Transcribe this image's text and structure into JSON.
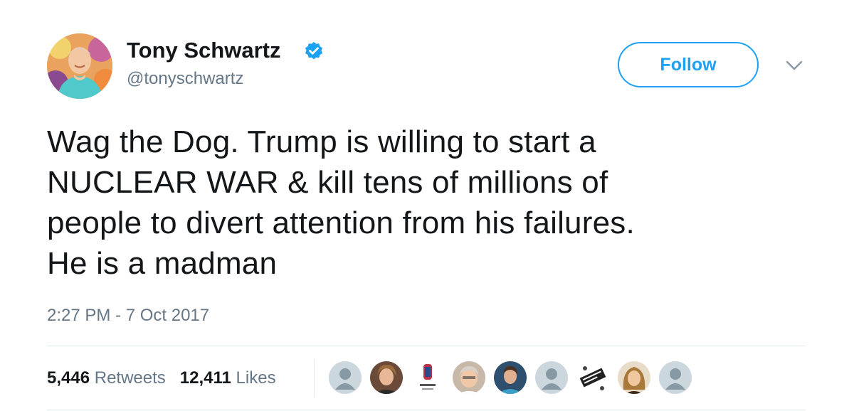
{
  "user": {
    "display_name": "Tony Schwartz",
    "handle": "@tonyschwartz",
    "verified": true
  },
  "actions": {
    "follow_label": "Follow"
  },
  "tweet": {
    "lines": [
      "Wag the Dog. Trump is willing to start a",
      "NUCLEAR WAR & kill tens of millions of",
      "people to divert attention from his failures.",
      "He is a madman"
    ],
    "timestamp": "2:27 PM - 7 Oct 2017"
  },
  "stats": {
    "retweets_count": "5,446",
    "retweets_label": "Retweets",
    "likes_count": "12,411",
    "likes_label": "Likes"
  },
  "likers": [
    {
      "icon": "default-avatar-icon"
    },
    {
      "icon": "user-photo-avatar"
    },
    {
      "icon": "fist-logo-avatar"
    },
    {
      "icon": "user-photo-avatar"
    },
    {
      "icon": "user-photo-avatar"
    },
    {
      "icon": "default-avatar-icon"
    },
    {
      "icon": "stamp-logo-avatar"
    },
    {
      "icon": "user-photo-avatar"
    },
    {
      "icon": "default-avatar-icon"
    }
  ],
  "colors": {
    "accent": "#1da1f2",
    "text": "#14171a",
    "muted": "#657786",
    "divider": "#e1e8ed"
  }
}
